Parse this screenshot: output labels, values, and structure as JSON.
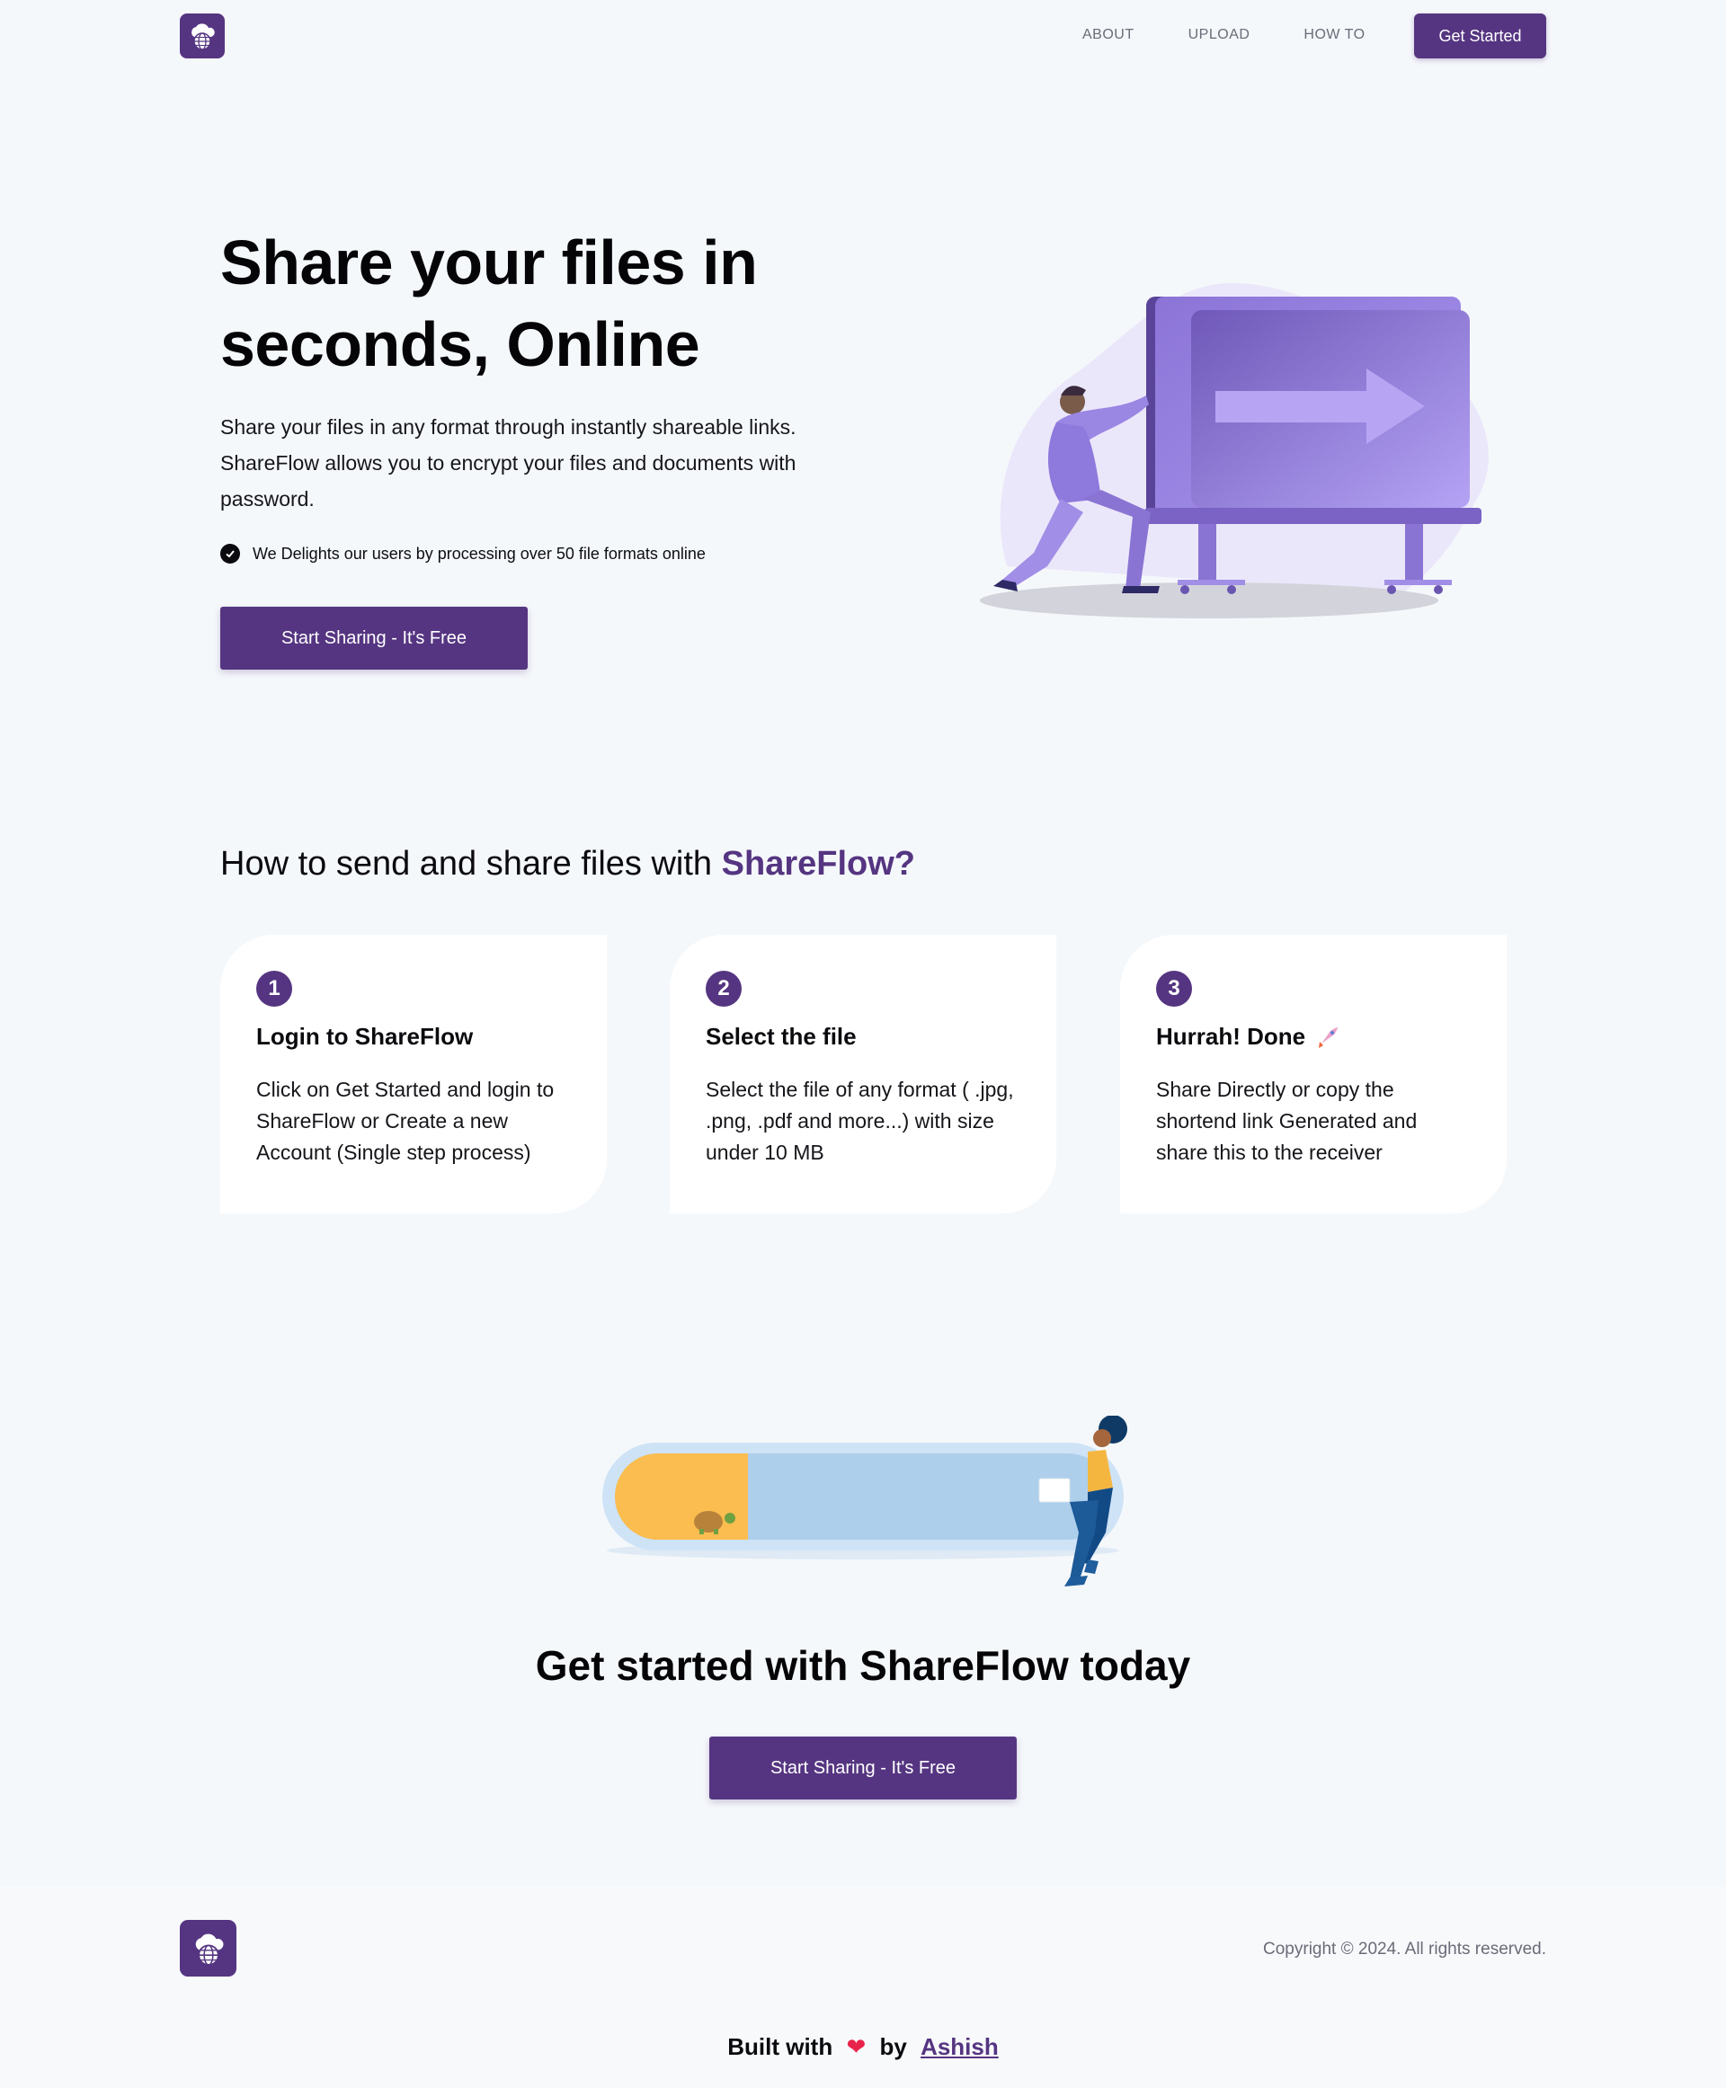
{
  "nav": {
    "links": [
      "ABOUT",
      "UPLOAD",
      "HOW TO"
    ],
    "cta_label": "Get Started"
  },
  "hero": {
    "title": "Share your files in seconds, Online",
    "description": "Share your files in any format through instantly shareable links. ShareFlow allows you to encrypt your files and documents with password.",
    "check_text": "We Delights our users by processing over 50 file formats online",
    "cta_label": "Start Sharing - It's Free"
  },
  "how_to": {
    "title_prefix": "How to send and share files with",
    "title_brand": "ShareFlow?",
    "steps": [
      {
        "number": "1",
        "title": "Login to ShareFlow",
        "description": "Click on Get Started and login to ShareFlow or Create a new Account (Single step process)"
      },
      {
        "number": "2",
        "title": "Select the file",
        "description": "Select the file of any format ( .jpg, .png, .pdf and more...) with size under 10 MB"
      },
      {
        "number": "3",
        "title": "Hurrah! Done",
        "description": "Share Directly or copy the shortend link Generated and share this to the receiver"
      }
    ]
  },
  "cta_section": {
    "title": "Get started with ShareFlow today",
    "cta_label": "Start Sharing - It's Free"
  },
  "footer": {
    "copyright": "Copyright © 2024. All rights reserved.",
    "built_prefix": "Built with",
    "built_by": "by",
    "author": "Ashish"
  },
  "colors": {
    "brand": "#553581",
    "background": "#f5f8fb",
    "card": "#ffffff",
    "heart": "#e8244a"
  },
  "icons": [
    "cloud-globe-logo-icon",
    "check-circle-icon",
    "rocket-icon",
    "heart-icon"
  ]
}
